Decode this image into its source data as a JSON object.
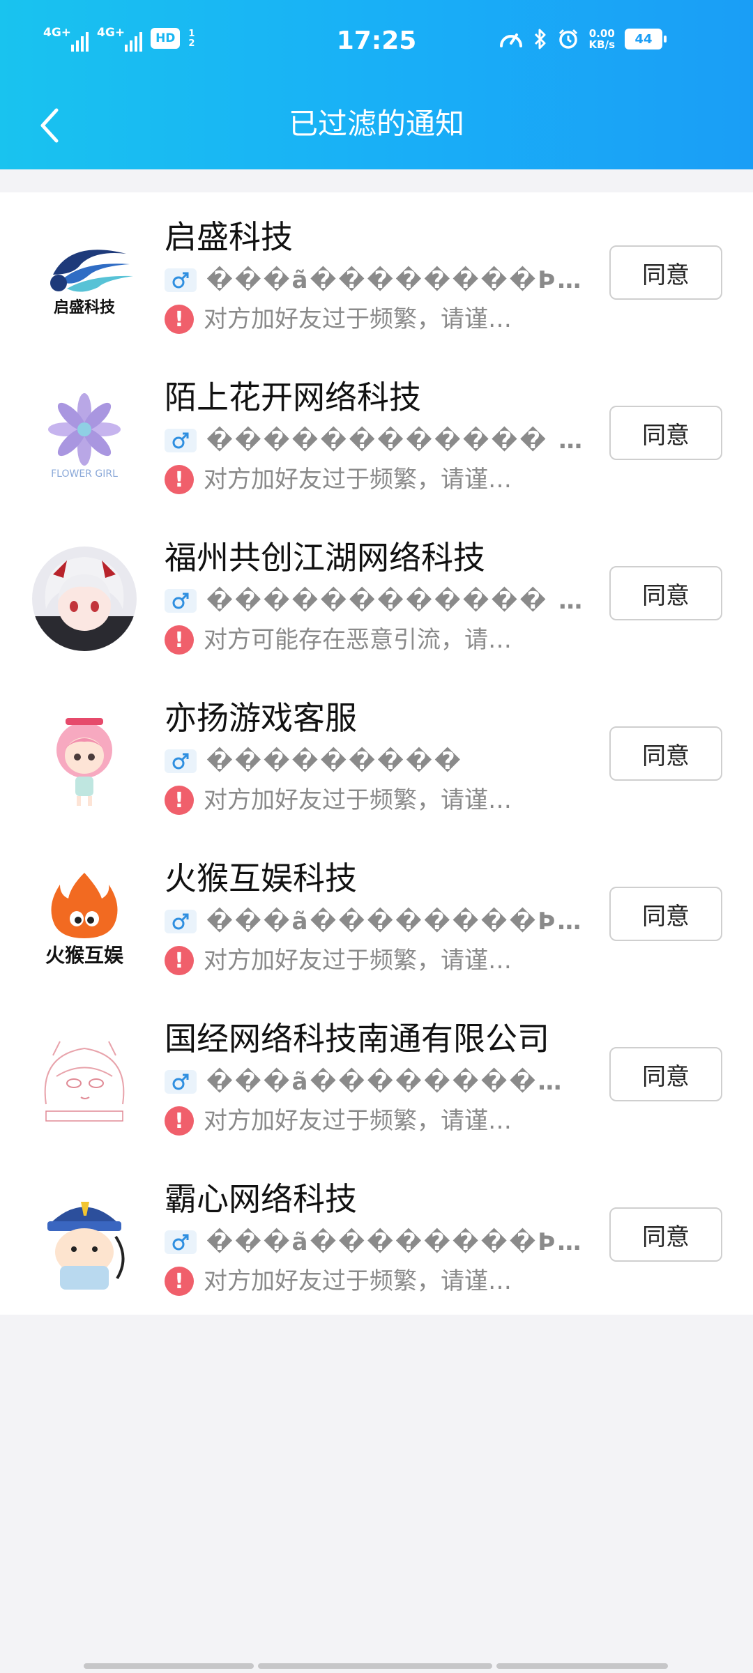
{
  "status_bar": {
    "signal1": "4G+",
    "signal2": "4G+",
    "hd_badge": "HD",
    "hd_small": "1\n2",
    "time": "17:25",
    "net_speed_value": "0.00",
    "net_speed_unit": "KB/s",
    "battery": "44"
  },
  "nav": {
    "title": "已过滤的通知"
  },
  "requests": [
    {
      "name": "启盛科技",
      "signature": "���ã��������Þƺ�…",
      "warning": "对方加好友过于频繁，请谨…",
      "button": "同意"
    },
    {
      "name": "陌上花开网络科技",
      "signature": "������������ �…",
      "warning": "对方加好友过于频繁，请谨…",
      "button": "同意"
    },
    {
      "name": "福州共创江湖网络科技",
      "signature": "������������ �…",
      "warning": " 对方可能存在恶意引流，请…",
      "button": "同意"
    },
    {
      "name": "亦扬游戏客服",
      "signature": "���������",
      "warning": "对方加好友过于频繁，请谨…",
      "button": "同意"
    },
    {
      "name": "火猴互娱科技",
      "signature": "���ã��������Þƺ�…",
      "warning": "对方加好友过于频繁，请谨…",
      "button": "同意"
    },
    {
      "name": "国经网络科技南通有限公司",
      "signature": "���ã����������Ï…",
      "warning": "对方加好友过于频繁，请谨…",
      "button": "同意"
    },
    {
      "name": "霸心网络科技",
      "signature": "���ã��������Þ�и…",
      "warning": "对方加好友过于频繁，请谨…",
      "button": "同意"
    }
  ],
  "avatars": {
    "a1_text": "启盛科技",
    "a2_text": "FLOWER GIRL",
    "a5_text": "火猴互娱"
  },
  "colors": {
    "header_start": "#19c3ef",
    "header_end": "#1a9ef6",
    "warning": "#f05f6b",
    "gender_icon": "#2f8fe0"
  }
}
